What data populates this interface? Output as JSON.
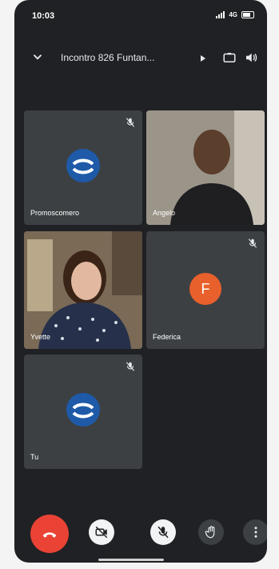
{
  "status": {
    "time": "10:03",
    "network": "4G"
  },
  "header": {
    "title": "Incontro 826 Funtan..."
  },
  "participants": [
    {
      "name": "Promoscomero",
      "muted": true,
      "avatar": "logo"
    },
    {
      "name": "Angelo",
      "muted": false,
      "avatar": "video"
    },
    {
      "name": "Yvette",
      "muted": false,
      "avatar": "video"
    },
    {
      "name": "Federica",
      "muted": true,
      "avatar": "letter",
      "initial": "F"
    },
    {
      "name": "Tu",
      "muted": true,
      "avatar": "logo"
    }
  ],
  "icons": {
    "mute": "mic-off-icon",
    "end_call": "phone-hangup-icon",
    "camera_off": "video-off-icon",
    "mic_off": "mic-off-icon",
    "raise_hand": "hand-icon",
    "more": "more-vertical-icon"
  },
  "colors": {
    "background": "#202124",
    "tile": "#3c4043",
    "end_call": "#ea4335",
    "avatar_logo": "#1e5aa8",
    "avatar_letter": "#e8602c",
    "selected_border": "#8ab4f8"
  }
}
